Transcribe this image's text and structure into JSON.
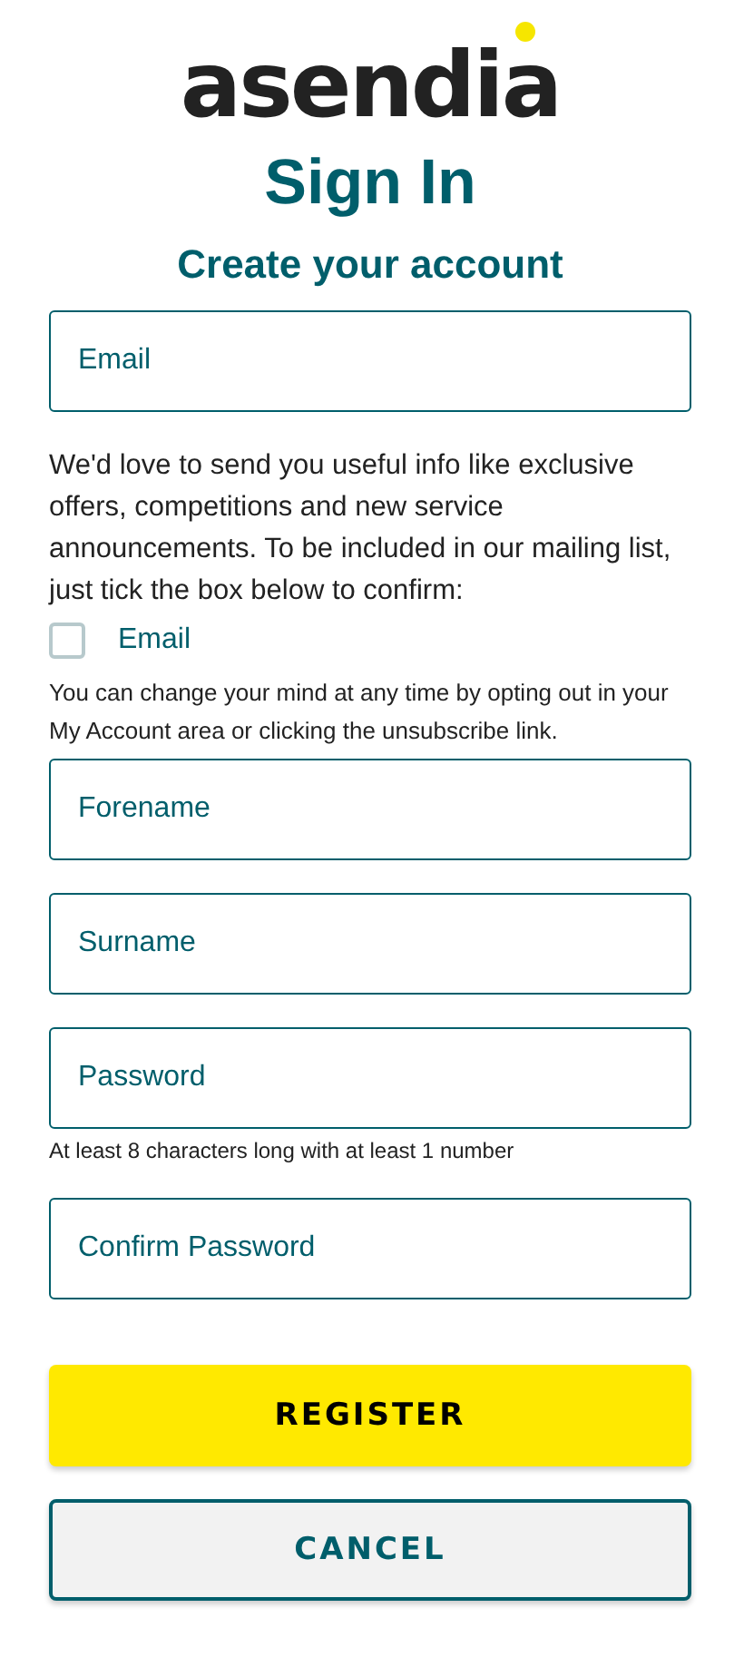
{
  "logo": "asendia",
  "title": "Sign In",
  "subtitle": "Create your account",
  "email_field": {
    "placeholder": "Email"
  },
  "consent_text": "We'd love to send you useful info like exclusive offers, competitions and new service announcements. To be included in our mailing list, just tick the box below to confirm:",
  "consent_checkbox": {
    "label": "Email",
    "checked": false
  },
  "consent_note": "You can change your mind at any time by opting out in your My Account area or clicking the unsubscribe link.",
  "fields": [
    {
      "placeholder": "Forename"
    },
    {
      "placeholder": "Surname"
    },
    {
      "placeholder": "Password",
      "hint": "At least 8 characters long with at least 1 number"
    },
    {
      "placeholder": "Confirm Password"
    }
  ],
  "buttons": [
    {
      "label": "REGISTER",
      "kind": "primary"
    },
    {
      "label": "CANCEL",
      "kind": "secondary"
    }
  ]
}
